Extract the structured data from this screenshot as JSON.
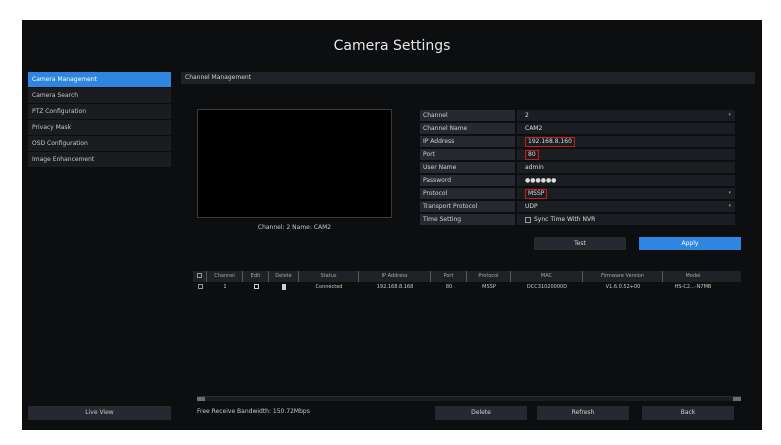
{
  "title": "Camera Settings",
  "sidebar": {
    "items": [
      {
        "label": "Camera Management",
        "active": true
      },
      {
        "label": "Camera Search",
        "active": false
      },
      {
        "label": "PTZ Configuration",
        "active": false
      },
      {
        "label": "Privacy Mask",
        "active": false
      },
      {
        "label": "OSD Configuration",
        "active": false
      },
      {
        "label": "Image Enhancement",
        "active": false
      }
    ],
    "live_view_label": "Live View"
  },
  "main": {
    "header": "Channel Management",
    "preview_caption": "Channel: 2 Name: CAM2"
  },
  "form": {
    "channel_label": "Channel",
    "channel_value": "2",
    "channel_name_label": "Channel Name",
    "channel_name_value": "CAM2",
    "ip_label": "IP Address",
    "ip_value": "192.168.8.160",
    "port_label": "Port",
    "port_value": "80",
    "username_label": "User Name",
    "username_value": "admin",
    "password_label": "Password",
    "password_value": "●●●●●●",
    "protocol_label": "Protocol",
    "protocol_value": "MSSP",
    "transport_label": "Transport Protocol",
    "transport_value": "UDP",
    "time_label": "Time Setting",
    "time_value": "Sync Time With NVR",
    "test_label": "Test",
    "apply_label": "Apply"
  },
  "table": {
    "headers": [
      "",
      "Channel",
      "Edit",
      "Delete",
      "Status",
      "IP Address",
      "Port",
      "Protocol",
      "MAC",
      "Firmware Version",
      "Model"
    ],
    "rows": [
      [
        "",
        "1",
        "",
        "",
        "Connected",
        "192.168.8.168",
        "80",
        "MSSP",
        "DCC31020000D",
        "V1.6.0.52+00",
        "HS-C2...-N7MB"
      ]
    ]
  },
  "footer": {
    "bandwidth": "Free Receive Bandwidth: 150.72Mbps",
    "delete_label": "Delete",
    "refresh_label": "Refresh",
    "back_label": "Back"
  },
  "colors": {
    "accent": "#2f86e0",
    "highlight_box": "#d01818",
    "background": "#0d0e10"
  }
}
